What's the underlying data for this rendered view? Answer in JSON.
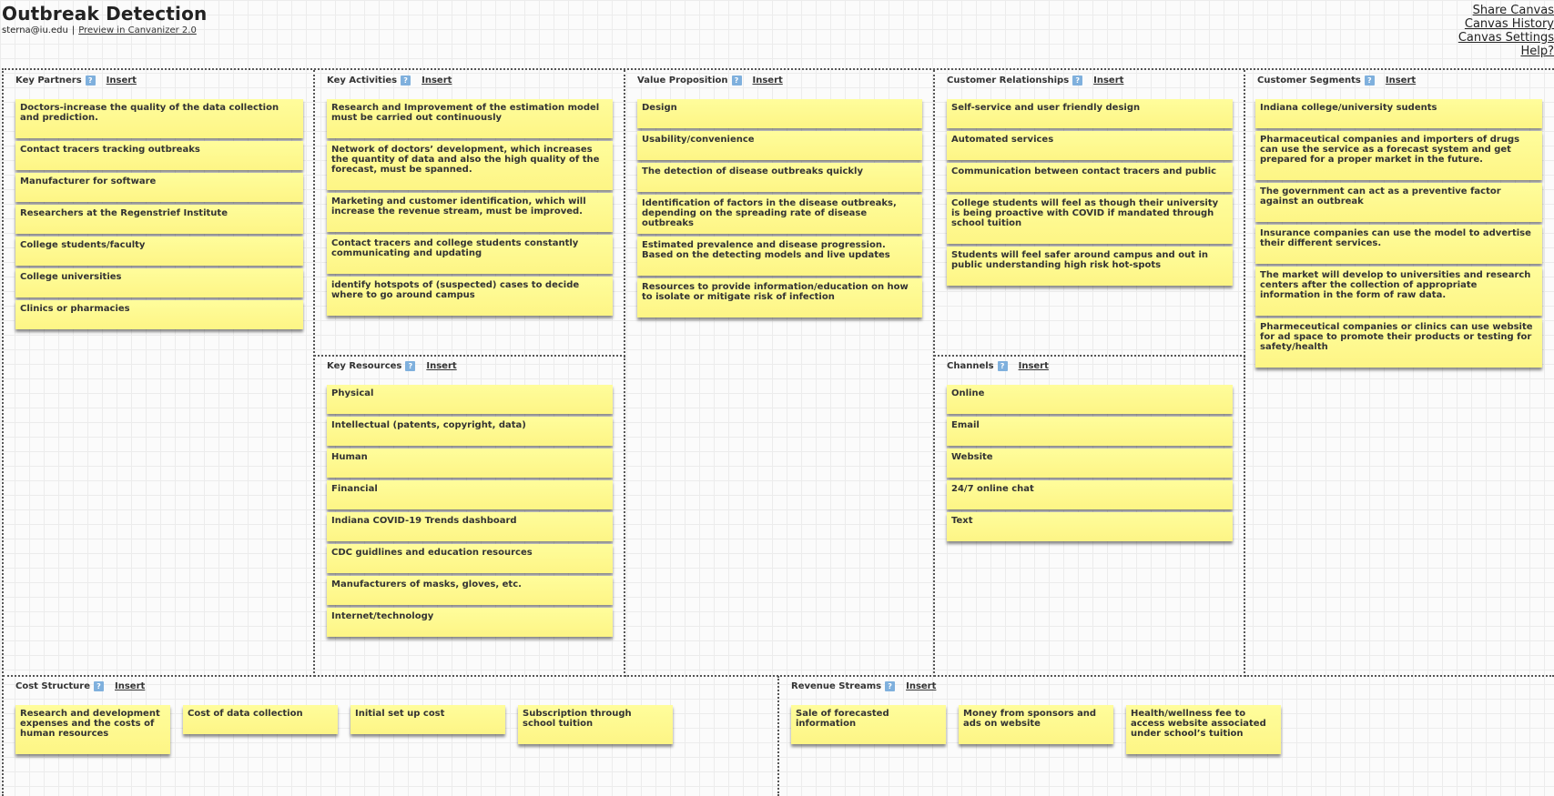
{
  "app": {
    "title": "Outbreak Detection",
    "user_email": "sterna@iu.edu",
    "separator": "|",
    "preview_link": "Preview in Canvanizer 2.0"
  },
  "top_links": {
    "share": "Share Canvas",
    "history": "Canvas History",
    "settings": "Canvas Settings",
    "help": "Help?"
  },
  "help_icon_glyph": "?",
  "insert_label": "Insert",
  "colors": {
    "note": "#fdf98a",
    "help_icon": "#7fb0dd",
    "border": "#555555"
  },
  "blocks": {
    "key_partners": {
      "title": "Key Partners",
      "notes": [
        "Doctors-increase the quality of the data collection and prediction.",
        "Contact tracers tracking outbreaks",
        "Manufacturer for software",
        "Researchers at the Regenstrief Institute",
        "College students/faculty",
        "College universities",
        "Clinics or pharmacies"
      ]
    },
    "key_activities": {
      "title": "Key Activities",
      "notes": [
        "Research and Improvement of the estimation model must be carried out continuously",
        "Network of doctors’ development, which increases the quantity of data and also the high quality of the forecast, must be spanned.",
        "Marketing and customer identification, which will increase the revenue stream, must be improved.",
        "Contact tracers and college students constantly communicating and updating",
        "identify hotspots of (suspected) cases to decide where to go around campus"
      ]
    },
    "key_resources": {
      "title": "Key Resources",
      "notes": [
        "Physical",
        "Intellectual (patents, copyright, data)",
        "Human",
        "Financial",
        "Indiana COVID-19 Trends dashboard",
        "CDC guidlines and education resources",
        "Manufacturers of masks, gloves, etc.",
        "Internet/technology"
      ]
    },
    "value_proposition": {
      "title": "Value Proposition",
      "notes": [
        "Design",
        "Usability/convenience",
        "The detection of disease outbreaks quickly",
        "Identification of factors in the disease outbreaks, depending on the spreading rate of disease outbreaks",
        "Estimated prevalence and disease progression. Based on the detecting models and live updates",
        "Resources to provide information/education on how to isolate or mitigate risk of infection"
      ]
    },
    "customer_relationships": {
      "title": "Customer Relationships",
      "notes": [
        "Self-service and user friendly design",
        "Automated services",
        "Communication between contact tracers and public",
        "College students will feel as though their university is being proactive with COVID if mandated through school tuition",
        "Students will feel safer around campus and out in public understanding high risk hot-spots"
      ]
    },
    "channels": {
      "title": "Channels",
      "notes": [
        "Online",
        "Email",
        "Website",
        "24/7 online chat",
        "Text"
      ]
    },
    "customer_segments": {
      "title": "Customer Segments",
      "notes": [
        "Indiana college/university sudents",
        "Pharmaceutical companies and importers of drugs can use the service as a forecast system and get prepared for a proper market in the future.",
        "The government can act as a preventive factor against an outbreak",
        "Insurance companies can use the model to advertise their different services.",
        "The market will develop to universities and research centers after the collection of appropriate information in the form of raw data.",
        "Pharmeceutical companies or clinics can use website for ad space to promote their products or testing for safety/health"
      ]
    },
    "cost_structure": {
      "title": "Cost Structure",
      "notes": [
        "Research and development expenses and the costs of human resources",
        "Cost of data collection",
        "Initial set up cost",
        "Subscription through school tuition"
      ]
    },
    "revenue_streams": {
      "title": "Revenue Streams",
      "notes": [
        "Sale of forecasted information",
        "Money from sponsors and ads on website",
        "Health/wellness fee to access website associated under school’s tuition"
      ]
    }
  }
}
